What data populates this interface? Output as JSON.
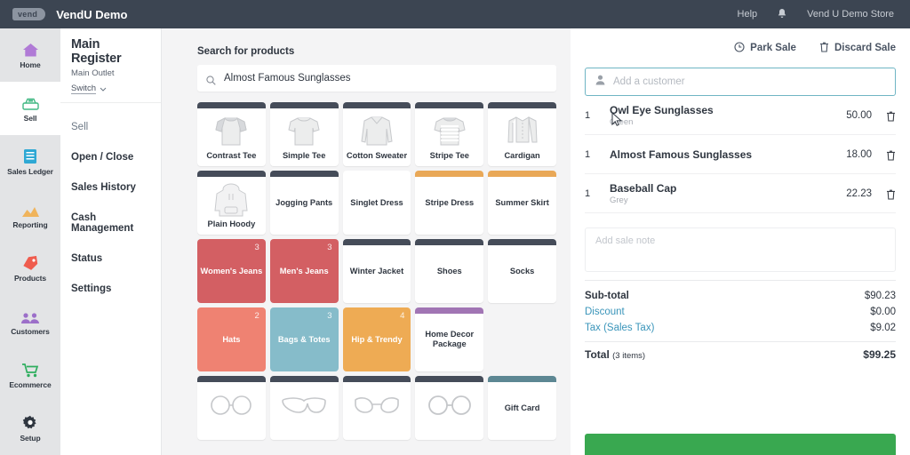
{
  "topbar": {
    "logo_text": "vend",
    "brand_title": "VendU Demo",
    "help_label": "Help",
    "bell_icon": "bell-icon",
    "store_name": "Vend U Demo Store"
  },
  "rail": {
    "items": [
      {
        "label": "Home",
        "icon": "home-icon",
        "active": false
      },
      {
        "label": "Sell",
        "icon": "register-icon",
        "active": true
      },
      {
        "label": "Sales Ledger",
        "icon": "ledger-icon",
        "active": false
      },
      {
        "label": "Reporting",
        "icon": "chart-icon",
        "active": false
      },
      {
        "label": "Products",
        "icon": "tag-icon",
        "active": false
      },
      {
        "label": "Customers",
        "icon": "people-icon",
        "active": false
      },
      {
        "label": "Ecommerce",
        "icon": "cart-icon",
        "active": false
      },
      {
        "label": "Setup",
        "icon": "gear-icon",
        "active": false
      }
    ]
  },
  "subnav": {
    "register_name": "Main Register",
    "outlet_name": "Main Outlet",
    "switch_label": "Switch",
    "switch_icon": "chevron-down-icon",
    "items": [
      {
        "label": "Sell",
        "current": true
      },
      {
        "label": "Open / Close",
        "current": false
      },
      {
        "label": "Sales History",
        "current": false
      },
      {
        "label": "Cash Management",
        "current": false
      },
      {
        "label": "Status",
        "current": false
      },
      {
        "label": "Settings",
        "current": false
      }
    ]
  },
  "search": {
    "label": "Search for products",
    "value": "Almost Famous Sunglasses",
    "placeholder": "Search for products",
    "icon": "search-icon"
  },
  "products": [
    {
      "name": "Contrast Tee",
      "style": "art",
      "art": "tee-contrast",
      "bar": "#454c59",
      "count": ""
    },
    {
      "name": "Simple Tee",
      "style": "art",
      "art": "tee-simple",
      "bar": "#454c59",
      "count": ""
    },
    {
      "name": "Cotton Sweater",
      "style": "art",
      "art": "sweater",
      "bar": "#454c59",
      "count": ""
    },
    {
      "name": "Stripe Tee",
      "style": "art",
      "art": "tee-stripe",
      "bar": "#454c59",
      "count": ""
    },
    {
      "name": "Cardigan",
      "style": "art",
      "art": "cardigan",
      "bar": "#454c59",
      "count": ""
    },
    {
      "name": "Plain Hoody",
      "style": "art",
      "art": "hoody",
      "bar": "#454c59",
      "count": ""
    },
    {
      "name": "Jogging Pants",
      "style": "plain",
      "art": "",
      "bar": "#454c59",
      "count": ""
    },
    {
      "name": "Singlet Dress",
      "style": "plain",
      "art": "",
      "bar": "#e9a košice",
      "count": ""
    },
    {
      "name": "Stripe Dress",
      "style": "plain",
      "art": "",
      "bar": "#e9a857",
      "count": ""
    },
    {
      "name": "Summer Skirt",
      "style": "plain",
      "art": "",
      "bar": "#e9a857",
      "count": ""
    },
    {
      "name": "Women's Jeans",
      "style": "solid",
      "art": "",
      "bar": "#d35f63",
      "count": "3"
    },
    {
      "name": "Men's Jeans",
      "style": "solid",
      "art": "",
      "bar": "#d35f63",
      "count": "3"
    },
    {
      "name": "Winter Jacket",
      "style": "plain",
      "art": "",
      "bar": "#454c59",
      "count": ""
    },
    {
      "name": "Shoes",
      "style": "plain",
      "art": "",
      "bar": "#454c59",
      "count": ""
    },
    {
      "name": "Socks",
      "style": "plain",
      "art": "",
      "bar": "#454c59",
      "count": ""
    },
    {
      "name": "Hats",
      "style": "solid",
      "art": "",
      "bar": "#ef8272",
      "count": "2"
    },
    {
      "name": "Bags & Totes",
      "style": "solid",
      "art": "",
      "bar": "#86bcca",
      "count": "3"
    },
    {
      "name": "Hip & Trendy",
      "style": "solid",
      "art": "",
      "bar": "#eeab54",
      "count": "4"
    },
    {
      "name": "Home Decor Package",
      "style": "plain",
      "art": "",
      "bar": "#a175b4",
      "count": ""
    },
    {
      "name": "",
      "style": "empty",
      "art": "",
      "bar": "",
      "count": ""
    },
    {
      "name": "",
      "style": "art",
      "art": "glasses-round",
      "bar": "#454c59",
      "count": ""
    },
    {
      "name": "",
      "style": "art",
      "art": "glasses-wayfarer",
      "bar": "#454c59",
      "count": ""
    },
    {
      "name": "",
      "style": "art",
      "art": "glasses-cat",
      "bar": "#454c59",
      "count": ""
    },
    {
      "name": "",
      "style": "art",
      "art": "glasses-owl",
      "bar": "#454c59",
      "count": ""
    },
    {
      "name": "Gift Card",
      "style": "plain",
      "art": "",
      "bar": "#5d8793",
      "count": ""
    }
  ],
  "cart": {
    "park_sale_label": "Park Sale",
    "park_sale_icon": "clock-icon",
    "discard_sale_label": "Discard Sale",
    "discard_sale_icon": "trash-icon",
    "customer_placeholder": "Add a customer",
    "customer_icon": "person-icon",
    "lines": [
      {
        "qty": "1",
        "name": "Owl Eye Sunglasses",
        "variant": "Green",
        "price": "50.00",
        "delete_icon": "trash-icon"
      },
      {
        "qty": "1",
        "name": "Almost Famous Sunglasses",
        "variant": "",
        "price": "18.00",
        "delete_icon": "trash-icon"
      },
      {
        "qty": "1",
        "name": "Baseball Cap",
        "variant": "Grey",
        "price": "22.23",
        "delete_icon": "trash-icon"
      }
    ],
    "note_placeholder": "Add sale note",
    "totals": [
      {
        "label": "Sub-total",
        "amount": "$90.23",
        "link": false
      },
      {
        "label": "Discount",
        "amount": "$0.00",
        "link": true
      },
      {
        "label": "Tax (Sales Tax)",
        "amount": "$9.02",
        "link": true
      }
    ],
    "grand_label": "Total",
    "grand_sub": "(3 items)",
    "grand_amount": "$99.25",
    "pay_button_label": "",
    "pay_button_color": "#39a850"
  },
  "colors": {
    "topbar_bg": "#3c4552",
    "rail_bg": "#e3e4e6",
    "accent_teal": "#6fb5c4",
    "link_blue": "#3a95ba",
    "pay_green": "#39a850"
  }
}
